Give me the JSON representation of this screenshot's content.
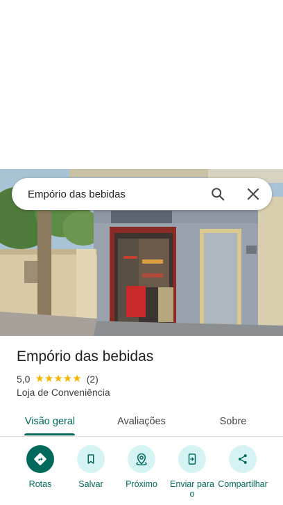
{
  "search": {
    "query": "Empório das bebidas"
  },
  "place": {
    "name": "Empório das bebidas",
    "rating": "5,0",
    "stars": 5,
    "review_count": "(2)",
    "category": "Loja de Conveniência"
  },
  "tabs": [
    {
      "label": "Visão geral",
      "active": true
    },
    {
      "label": "Avaliações",
      "active": false
    },
    {
      "label": "Sobre",
      "active": false
    }
  ],
  "actions": [
    {
      "label": "Rotas",
      "icon": "directions-icon"
    },
    {
      "label": "Salvar",
      "icon": "bookmark-icon"
    },
    {
      "label": "Próximo",
      "icon": "nearby-icon"
    },
    {
      "label": "Enviar para o",
      "icon": "send-to-phone-icon"
    },
    {
      "label": "Compartilhar",
      "icon": "share-icon"
    }
  ],
  "colors": {
    "accent": "#00695c",
    "chip": "#d6f3f3",
    "star": "#f5b400"
  }
}
